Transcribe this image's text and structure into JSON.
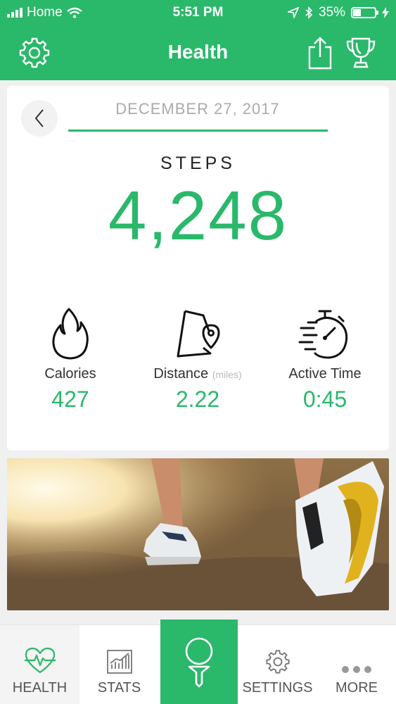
{
  "status_bar": {
    "carrier": "Home",
    "time": "5:51 PM",
    "battery_percent": "35%",
    "battery_level": 0.35
  },
  "header": {
    "title": "Health"
  },
  "date_nav": {
    "date": "DECEMBER 27, 2017"
  },
  "steps": {
    "label": "STEPS",
    "value": "4,248"
  },
  "metrics": [
    {
      "label": "Calories",
      "unit": "",
      "value": "427",
      "icon": "flame-icon"
    },
    {
      "label": "Distance",
      "unit": "(miles)",
      "value": "2.22",
      "icon": "route-pin-icon"
    },
    {
      "label": "Active Time",
      "unit": "",
      "value": "0:45",
      "icon": "stopwatch-icon"
    }
  ],
  "tabs": [
    {
      "label": "HEALTH",
      "icon": "heartbeat-icon",
      "active": true
    },
    {
      "label": "STATS",
      "icon": "bar-chart-icon",
      "active": false
    },
    {
      "label": "",
      "icon": "golf-ball-tee-icon",
      "active": false
    },
    {
      "label": "SETTINGS",
      "icon": "gear-icon",
      "active": false
    },
    {
      "label": "MORE",
      "icon": "more-dots-icon",
      "active": false
    }
  ],
  "colors": {
    "accent": "#2ab86a",
    "background": "#f0f0f0"
  }
}
